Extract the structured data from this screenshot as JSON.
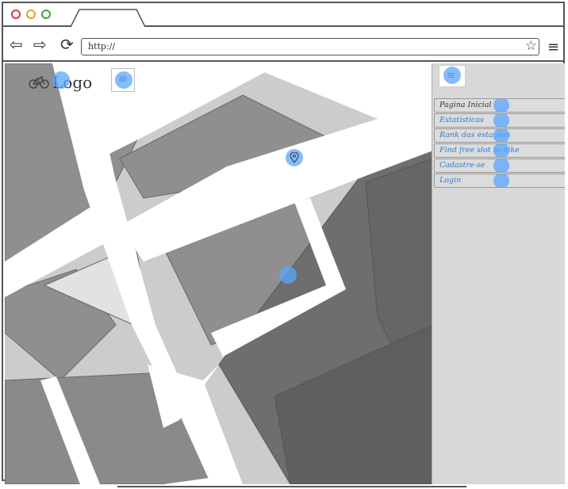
{
  "browser": {
    "url": "http://",
    "colors": {
      "close": "#d33c3c",
      "minimize": "#e0a22b",
      "maximize": "#3aa83a"
    }
  },
  "header": {
    "logo_text": "Logo",
    "logo_icon": "bicycle-icon"
  },
  "map": {
    "marker_icon": "location-pin-icon"
  },
  "side_menu": {
    "items": [
      {
        "label": "Pagina Inicial"
      },
      {
        "label": "Estatísticas"
      },
      {
        "label": "Rank das estações"
      },
      {
        "label": "Find free slot to bike"
      },
      {
        "label": "Cadastre-se"
      },
      {
        "label": "Login"
      }
    ]
  }
}
